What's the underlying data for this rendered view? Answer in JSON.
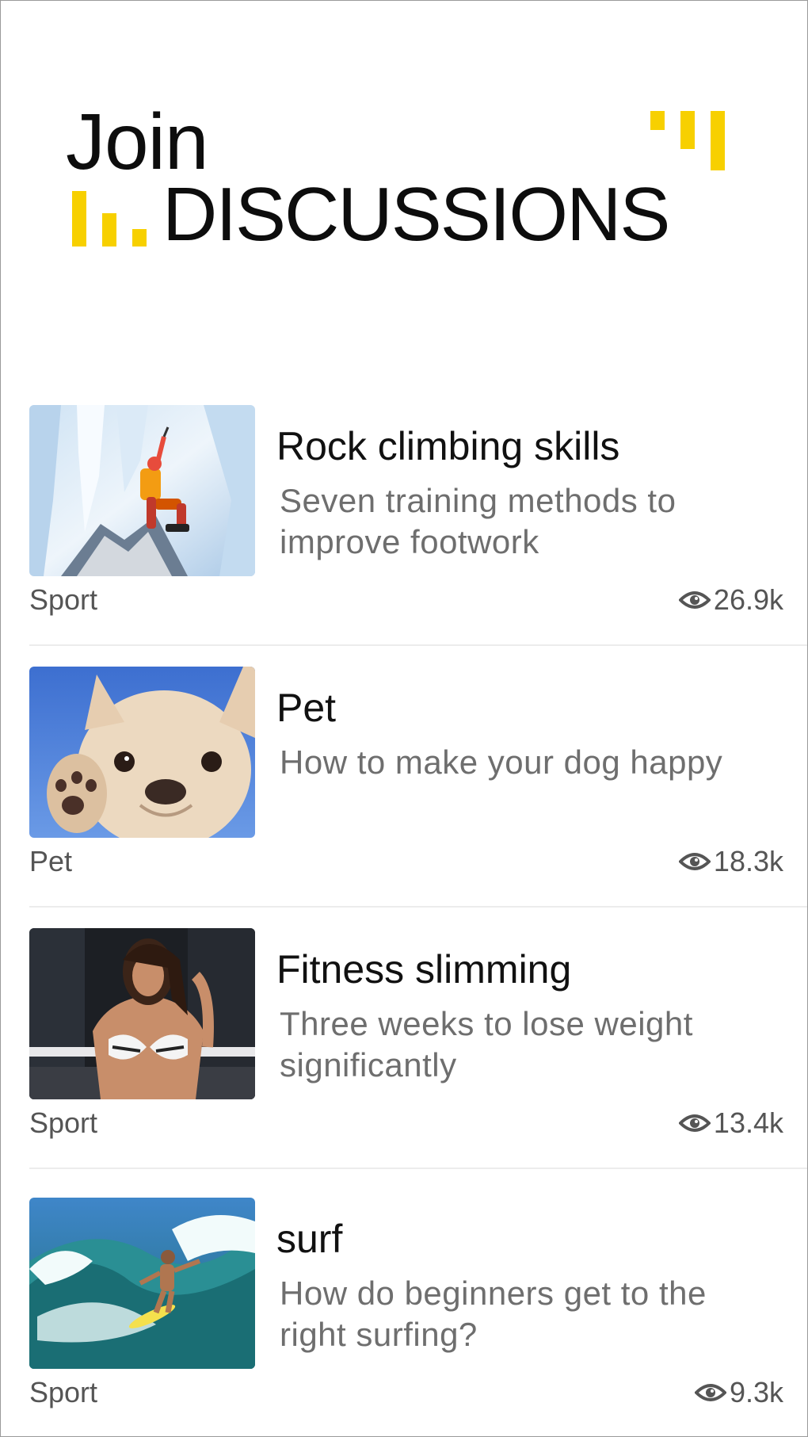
{
  "header": {
    "line1": "Join",
    "line2": "DISCUSSIONS",
    "accent_color": "#f7d000"
  },
  "topics": [
    {
      "image": "ice-climber-photo",
      "title": "Rock climbing skills",
      "description": "Seven training methods to improve footwork",
      "category": "Sport",
      "views": "26.9k"
    },
    {
      "image": "french-bulldog-photo",
      "title": "Pet",
      "description": "How to make your dog happy",
      "category": "Pet",
      "views": "18.3k"
    },
    {
      "image": "fitness-woman-photo",
      "title": "Fitness slimming",
      "description": "Three weeks to lose weight significantly",
      "category": "Sport",
      "views": "13.4k"
    },
    {
      "image": "surfer-wave-photo",
      "title": "surf",
      "description": "How do beginners get to the right surfing?",
      "category": "Sport",
      "views": "9.3k"
    }
  ],
  "icons": {
    "views": "eye-icon"
  }
}
